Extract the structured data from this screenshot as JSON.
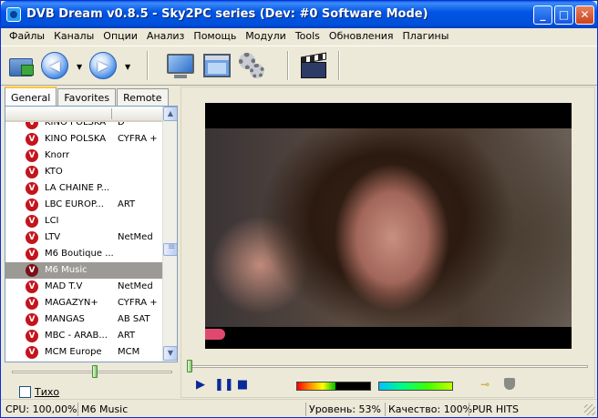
{
  "window": {
    "title": "DVB Dream v0.8.5 - Sky2PC series (Dev: #0 Software Mode)",
    "buttons": {
      "minimize": "_",
      "maximize": "□",
      "close": "✕"
    }
  },
  "menu": [
    "Файлы",
    "Каналы",
    "Опции",
    "Анализ",
    "Помощь",
    "Модули",
    "Tools",
    "Обновления",
    "Плагины"
  ],
  "toolbar": {
    "icons": [
      "open-folder-icon",
      "back-arrow-icon",
      "forward-arrow-icon",
      "monitor-icon",
      "window-icon",
      "settings-gears-icon",
      "clapperboard-icon"
    ],
    "back_glyph": "◀",
    "forward_glyph": "▶",
    "dropdown_glyph": "▼"
  },
  "tabs": [
    "General",
    "Favorites",
    "Remote"
  ],
  "channels": [
    {
      "name": "KINO POLSKA",
      "provider": "D"
    },
    {
      "name": "KINO POLSKA",
      "provider": "CYFRA +"
    },
    {
      "name": "Knorr",
      "provider": ""
    },
    {
      "name": "KTO",
      "provider": ""
    },
    {
      "name": "LA CHAINE P...",
      "provider": ""
    },
    {
      "name": "LBC EUROP...",
      "provider": "ART"
    },
    {
      "name": "LCI",
      "provider": ""
    },
    {
      "name": "LTV",
      "provider": "NetMed"
    },
    {
      "name": "M6 Boutique ...",
      "provider": ""
    },
    {
      "name": "M6 Music",
      "provider": ""
    },
    {
      "name": "MAD T.V",
      "provider": "NetMed"
    },
    {
      "name": "MAGAZYN+",
      "provider": "CYFRA +"
    },
    {
      "name": "MANGAS",
      "provider": "AB SAT"
    },
    {
      "name": "MBC - ARAB...",
      "provider": "ART"
    },
    {
      "name": "MCM Europe",
      "provider": "MCM"
    }
  ],
  "channel_icon_letter": "V",
  "selected_channel_index": 9,
  "scroll_glyphs": {
    "up": "▲",
    "down": "▼"
  },
  "volume": {
    "position": 0.52
  },
  "mute_label": "Тихо",
  "playback": {
    "seek_position": 0.0,
    "play_glyph": "▶",
    "pause_glyph": "❚❚",
    "stop_glyph": "■",
    "key_glyph": "⊸",
    "level_fill": 0.53,
    "quality_fill": 1.0
  },
  "status": {
    "cpu": "CPU: 100,00%",
    "channel": "M6 Music",
    "level": "Уровень: 53%",
    "quality": "Качество: 100%",
    "provider": "PUR HITS"
  },
  "colors": {
    "titlebar": "#0055e5",
    "selection": "#9c9a94",
    "channel_icon": "#c4141c",
    "control_blue": "#0a2a9a"
  }
}
